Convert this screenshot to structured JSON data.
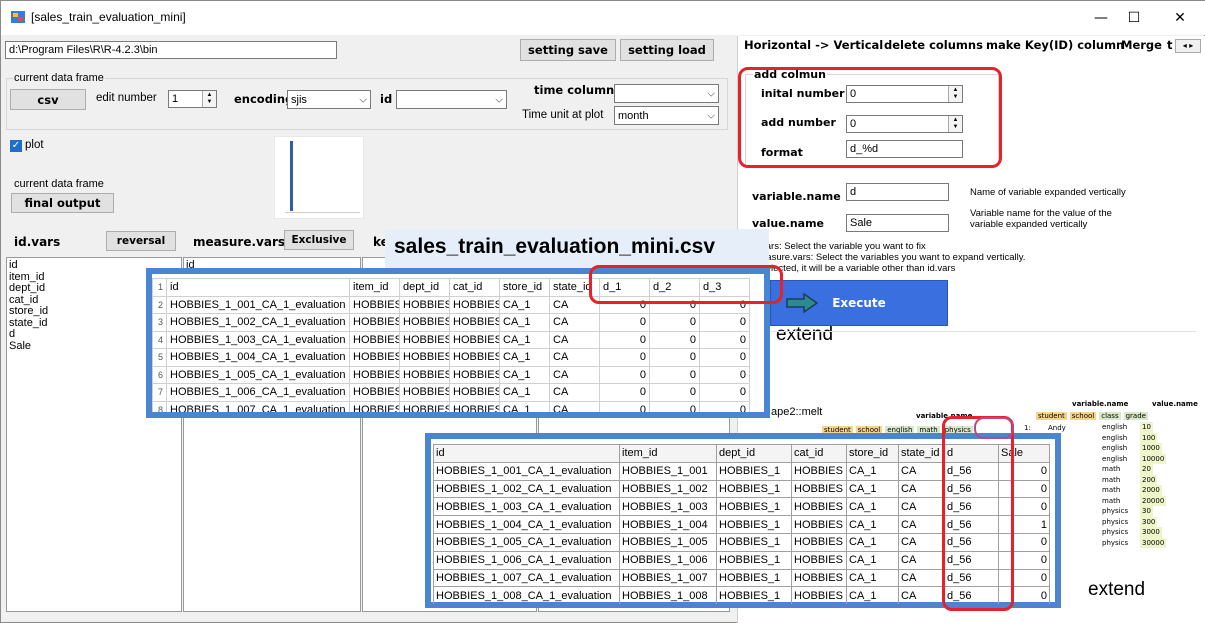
{
  "window": {
    "title": "[sales_train_evaluation_mini]",
    "minimize": "—",
    "maximize": "☐",
    "close": "✕"
  },
  "left": {
    "path_value": "d:\\Program Files\\R\\R-4.2.3\\bin",
    "setting_save": "setting save",
    "setting_load": "setting load",
    "current_data_frame_group": "current data frame",
    "csv_button": "csv",
    "edit_number_label": "edit number",
    "edit_number_value": "1",
    "encoding_label": "encoding",
    "encoding_value": "sjis",
    "id_label": "id",
    "id_value": "",
    "time_column_label": "time column",
    "time_column_value": "",
    "time_unit_label": "Time unit at plot",
    "time_unit_value": "month",
    "plot_label": "plot",
    "current_data_frame_label2": "current data frame",
    "final_output": "final output",
    "id_vars_label": "id.vars",
    "reversal": "reversal",
    "measure_vars_label": "measure.vars",
    "exclusive": "Exclusive",
    "key_label": "ke",
    "id_vars_items": [
      "id",
      "item_id",
      "dept_id",
      "cat_id",
      "store_id",
      "state_id",
      "d",
      "Sale"
    ],
    "measure_vars_first": "id"
  },
  "right": {
    "tabs": [
      "Horizontal -> Vertical",
      "delete columns",
      "make Key(ID) column",
      "Merge",
      "t"
    ],
    "add_column_group": "add colmun",
    "initial_number_label": "inital number",
    "initial_number_value": "0",
    "add_number_label": "add number",
    "add_number_value": "0",
    "format_label": "format",
    "format_value": "d_%d",
    "variable_name_label": "variable.name",
    "variable_name_value": "d",
    "variable_name_desc": "Name of variable expanded vertically",
    "value_name_label": "value.name",
    "value_name_value": "Sale",
    "value_name_desc": "Variable name for the value of the variable expanded vertically",
    "help_lines": [
      "vars: Select the variable you want to fix",
      "easure.vars: Select the variables you want to expand vertically.",
      "  selected, it will be a variable other than id.vars"
    ],
    "execute": "Execute",
    "extend1": "extend",
    "melt_label": "ape2::melt",
    "extend2": "extend"
  },
  "csv_title": "sales_train_evaluation_mini.csv",
  "top_table": {
    "headers": [
      "",
      "id",
      "item_id",
      "dept_id",
      "cat_id",
      "store_id",
      "state_id",
      "d_1",
      "d_2",
      "d_3"
    ],
    "rows": [
      [
        "2",
        "HOBBIES_1_001_CA_1_evaluation",
        "HOBBIES_",
        "HOBBIES_",
        "HOBBIES",
        "CA_1",
        "CA",
        "0",
        "0",
        "0"
      ],
      [
        "3",
        "HOBBIES_1_002_CA_1_evaluation",
        "HOBBIES_",
        "HOBBIES_",
        "HOBBIES",
        "CA_1",
        "CA",
        "0",
        "0",
        "0"
      ],
      [
        "4",
        "HOBBIES_1_003_CA_1_evaluation",
        "HOBBIES_",
        "HOBBIES_",
        "HOBBIES",
        "CA_1",
        "CA",
        "0",
        "0",
        "0"
      ],
      [
        "5",
        "HOBBIES_1_004_CA_1_evaluation",
        "HOBBIES_",
        "HOBBIES_",
        "HOBBIES",
        "CA_1",
        "CA",
        "0",
        "0",
        "0"
      ],
      [
        "6",
        "HOBBIES_1_005_CA_1_evaluation",
        "HOBBIES_",
        "HOBBIES_",
        "HOBBIES",
        "CA_1",
        "CA",
        "0",
        "0",
        "0"
      ],
      [
        "7",
        "HOBBIES_1_006_CA_1_evaluation",
        "HOBBIES_",
        "HOBBIES_",
        "HOBBIES",
        "CA_1",
        "CA",
        "0",
        "0",
        "0"
      ],
      [
        "8",
        "HOBBIES_1_007_CA_1_evaluation",
        "HOBBIES_",
        "HOBBIES_",
        "HOBBIES",
        "CA_1",
        "CA",
        "0",
        "0",
        "0"
      ]
    ]
  },
  "bottom_table": {
    "headers": [
      "id",
      "item_id",
      "dept_id",
      "cat_id",
      "store_id",
      "state_id",
      "d",
      "Sale"
    ],
    "rows": [
      [
        "HOBBIES_1_001_CA_1_evaluation",
        "HOBBIES_1_001",
        "HOBBIES_1",
        "HOBBIES",
        "CA_1",
        "CA",
        "d_56",
        "0"
      ],
      [
        "HOBBIES_1_002_CA_1_evaluation",
        "HOBBIES_1_002",
        "HOBBIES_1",
        "HOBBIES",
        "CA_1",
        "CA",
        "d_56",
        "0"
      ],
      [
        "HOBBIES_1_003_CA_1_evaluation",
        "HOBBIES_1_003",
        "HOBBIES_1",
        "HOBBIES",
        "CA_1",
        "CA",
        "d_56",
        "0"
      ],
      [
        "HOBBIES_1_004_CA_1_evaluation",
        "HOBBIES_1_004",
        "HOBBIES_1",
        "HOBBIES",
        "CA_1",
        "CA",
        "d_56",
        "1"
      ],
      [
        "HOBBIES_1_005_CA_1_evaluation",
        "HOBBIES_1_005",
        "HOBBIES_1",
        "HOBBIES",
        "CA_1",
        "CA",
        "d_56",
        "0"
      ],
      [
        "HOBBIES_1_006_CA_1_evaluation",
        "HOBBIES_1_006",
        "HOBBIES_1",
        "HOBBIES",
        "CA_1",
        "CA",
        "d_56",
        "0"
      ],
      [
        "HOBBIES_1_007_CA_1_evaluation",
        "HOBBIES_1_007",
        "HOBBIES_1",
        "HOBBIES",
        "CA_1",
        "CA",
        "d_56",
        "0"
      ],
      [
        "HOBBIES_1_008_CA_1_evaluation",
        "HOBBIES_1_008",
        "HOBBIES_1",
        "HOBBIES",
        "CA_1",
        "CA",
        "d_56",
        "0"
      ]
    ]
  },
  "melt_diagram": {
    "header_variable_name": "variable.name",
    "header_value_name": "value.name",
    "left_cols": [
      "student",
      "school",
      "english",
      "math",
      "physics"
    ],
    "left_variable_label": "variable.name",
    "right_cols": [
      "student",
      "school",
      "class",
      "grade"
    ],
    "row1": "1:",
    "row1_student": "Andy",
    "subjects": [
      "english",
      "english",
      "english",
      "english",
      "math",
      "math",
      "math",
      "math",
      "physics",
      "physics",
      "physics",
      "physics"
    ],
    "values": [
      "10",
      "100",
      "1000",
      "10000",
      "20",
      "200",
      "2000",
      "20000",
      "30",
      "300",
      "3000",
      "30000"
    ]
  },
  "colors": {
    "accent_blue": "#4a86d0",
    "highlight_red": "#e8202a",
    "execute_blue": "#3a6fe0"
  }
}
